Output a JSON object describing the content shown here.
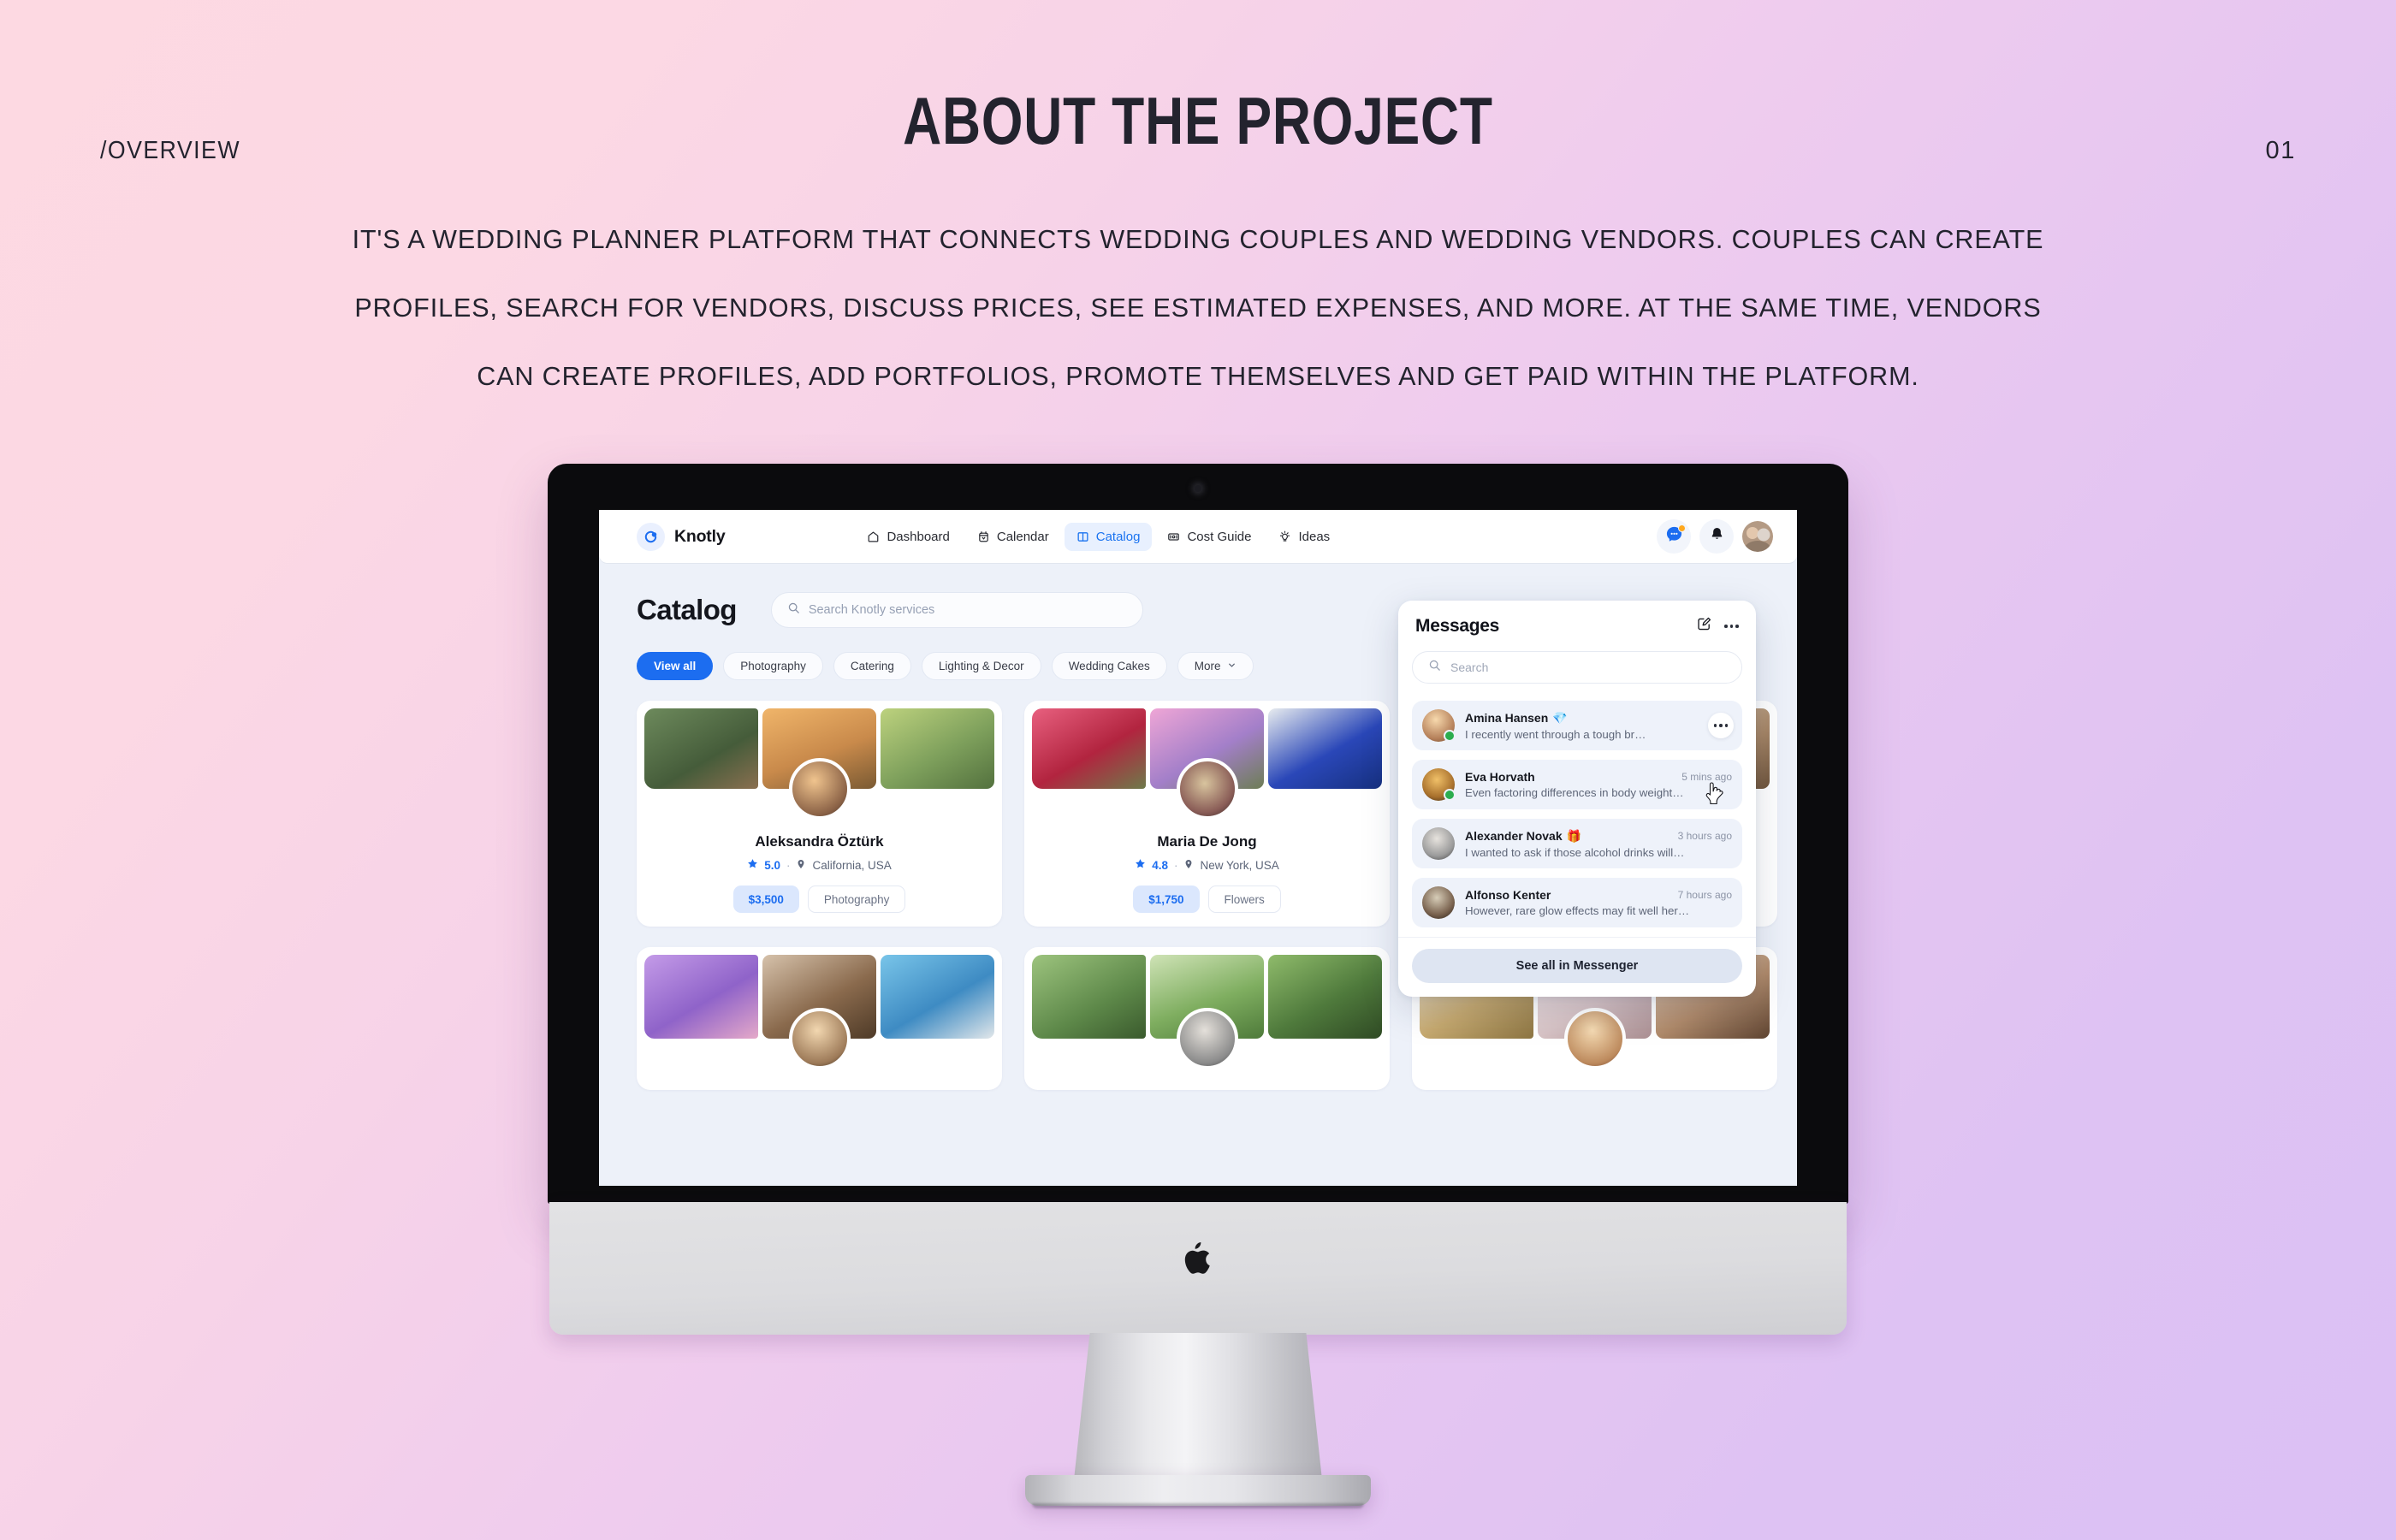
{
  "slide": {
    "title": "ABOUT THE PROJECT",
    "section_label": "/OVERVIEW",
    "page_number": "01",
    "description_lines": [
      "IT'S A WEDDING PLANNER PLATFORM THAT CONNECTS WEDDING COUPLES AND WEDDING VENDORS. COUPLES CAN CREATE",
      "PROFILES, SEARCH FOR VENDORS, DISCUSS PRICES, SEE ESTIMATED EXPENSES, AND MORE. AT THE SAME TIME, VENDORS",
      "CAN CREATE PROFILES, ADD PORTFOLIOS, PROMOTE THEMSELVES AND GET PAID WITHIN THE PLATFORM."
    ],
    "background_from": "#FDD9E2",
    "background_to": "#DBC0F4",
    "text_color": "#23232E"
  },
  "device": {
    "brand_logo": "apple-logo",
    "bezel_color": "#0B0B0D",
    "body_color": "#DCDCDF"
  },
  "app": {
    "brand": {
      "name": "Knotly",
      "logo_icon": "knotly-ring-icon",
      "accent": "#1C6DF0"
    },
    "nav": [
      {
        "label": "Dashboard",
        "icon": "home-icon",
        "active": false
      },
      {
        "label": "Calendar",
        "icon": "calendar-icon",
        "active": false
      },
      {
        "label": "Catalog",
        "icon": "book-icon",
        "active": true
      },
      {
        "label": "Cost Guide",
        "icon": "wallet-icon",
        "active": false
      },
      {
        "label": "Ideas",
        "icon": "bulb-icon",
        "active": false
      }
    ],
    "toolbar": {
      "messenger_icon": "messenger-icon",
      "messenger_badge": true,
      "notifications_icon": "bell-icon",
      "avatar_icon": "user-avatar"
    },
    "page": {
      "title": "Catalog",
      "search": {
        "placeholder": "Search Knotly services",
        "icon": "search-icon",
        "value": ""
      },
      "filters": [
        {
          "label": "View all",
          "active": true,
          "has_chevron": false
        },
        {
          "label": "Photography",
          "active": false,
          "has_chevron": false
        },
        {
          "label": "Catering",
          "active": false,
          "has_chevron": false
        },
        {
          "label": "Lighting & Decor",
          "active": false,
          "has_chevron": false
        },
        {
          "label": "Wedding Cakes",
          "active": false,
          "has_chevron": false
        },
        {
          "label": "More",
          "active": false,
          "has_chevron": true
        }
      ],
      "vendor_cards": [
        {
          "name": "Aleksandra Öztürk",
          "rating": "5.0",
          "location": "California, USA",
          "price": "$3,500",
          "category": "Photography",
          "star_icon": "star-icon",
          "pin_icon": "location-pin-icon",
          "gallery": [
            "#7B8F6E",
            "#C98A4B",
            "#8FA86B"
          ],
          "avatar_color": "#9c7b5d"
        },
        {
          "name": "Maria De Jong",
          "rating": "4.8",
          "location": "New York, USA",
          "price": "$1,750",
          "category": "Flowers",
          "star_icon": "star-icon",
          "pin_icon": "location-pin-icon",
          "gallery": [
            "#C64464",
            "#C789C0",
            "#2A47B8"
          ],
          "avatar_color": "#8a5d57"
        },
        {
          "name": "",
          "rating": "",
          "location": "",
          "price": "",
          "category": "",
          "star_icon": "star-icon",
          "pin_icon": "location-pin-icon",
          "gallery": [
            "#D4C7BA",
            "#CFB7A8",
            "#B59B80"
          ],
          "avatar_color": "#a88a6b"
        }
      ],
      "vendor_cards_row2": [
        {
          "gallery": [
            "#9B7FD4",
            "#B79A80",
            "#63AEDC"
          ],
          "avatar_color": "#c0a185"
        },
        {
          "gallery": [
            "#7FA86A",
            "#8FBF6D",
            "#5E9449"
          ],
          "avatar_color": "#8f8f8f"
        },
        {
          "gallery": [
            "#D8CBB3",
            "#E3D6CE",
            "#C2A187"
          ],
          "avatar_color": "#c2936f"
        }
      ]
    },
    "messages_panel": {
      "title": "Messages",
      "compose_icon": "compose-icon",
      "more_icon": "more-horizontal-icon",
      "search": {
        "placeholder": "Search",
        "icon": "search-icon",
        "value": ""
      },
      "conversations": [
        {
          "name": "Amina Hansen",
          "badge": "💎",
          "time": "",
          "snippet": "I recently went through a tough br…",
          "online": true,
          "hovered": true,
          "avatar_color": "#c9a27c"
        },
        {
          "name": "Eva Horvath",
          "badge": "",
          "time": "5 mins ago",
          "snippet": "Even factoring differences in body weight…",
          "online": true,
          "hovered": false,
          "avatar_color": "#d8a34a"
        },
        {
          "name": "Alexander Novak",
          "badge": "🎁",
          "time": "3 hours ago",
          "snippet": "I wanted to ask if those alcohol drinks will…",
          "online": false,
          "hovered": false,
          "avatar_color": "#b8b8b8"
        },
        {
          "name": "Alfonso Kenter",
          "badge": "",
          "time": "7 hours ago",
          "snippet": "However, rare glow effects may fit well her…",
          "online": false,
          "hovered": false,
          "avatar_color": "#7f6a56"
        }
      ],
      "footer_button": "See all in Messenger",
      "cursor_icon": "pointer-hand-cursor"
    }
  }
}
